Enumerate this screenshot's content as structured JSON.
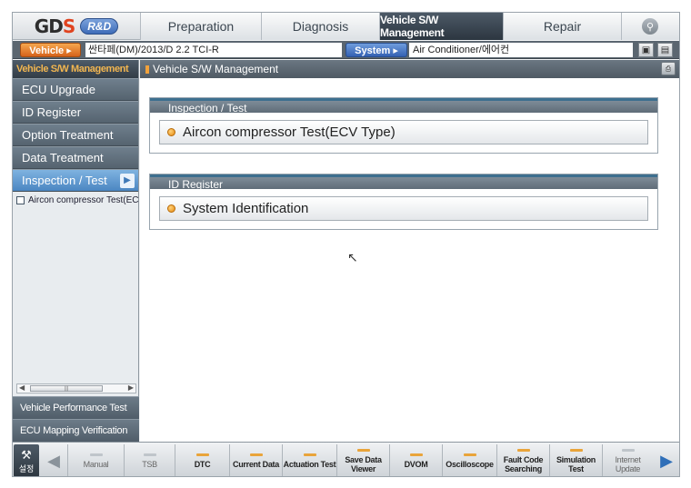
{
  "app": {
    "logo_main": "GDS",
    "logo_badge": "R&D"
  },
  "tabs": [
    {
      "label": "Preparation"
    },
    {
      "label": "Diagnosis"
    },
    {
      "label": "Vehicle S/W Management"
    },
    {
      "label": "Repair"
    }
  ],
  "vehicle_bar": {
    "vehicle_label": "Vehicle ▸",
    "vehicle_value": "싼타페(DM)/2013/D 2.2 TCI-R",
    "system_label": "System ▸",
    "system_value": "Air Conditioner/에어컨"
  },
  "sidebar": {
    "header": "Vehicle S/W Management",
    "items": [
      {
        "label": "ECU Upgrade"
      },
      {
        "label": "ID Register"
      },
      {
        "label": "Option Treatment"
      },
      {
        "label": "Data Treatment"
      },
      {
        "label": "Inspection / Test"
      }
    ],
    "sub_item": "Aircon compressor Test(ECV Type)",
    "bottom_items": [
      {
        "label": "Vehicle Performance Test"
      },
      {
        "label": "ECU Mapping Verification"
      }
    ]
  },
  "main": {
    "title": "Vehicle S/W Management",
    "groups": [
      {
        "title": "Inspection / Test",
        "item": "Aircon compressor Test(ECV Type)"
      },
      {
        "title": "ID Register",
        "item": "System Identification"
      }
    ]
  },
  "toolbar": {
    "settings_label": "설정",
    "buttons": [
      {
        "label": "Manual",
        "icon": "manual-icon"
      },
      {
        "label": "TSB",
        "icon": "tsb-icon"
      },
      {
        "label": "DTC",
        "icon": "dtc-icon"
      },
      {
        "label": "Current Data",
        "icon": "current-data-icon"
      },
      {
        "label": "Actuation Test",
        "icon": "actuation-icon"
      },
      {
        "label": "Save Data Viewer",
        "icon": "save-data-icon"
      },
      {
        "label": "DVOM",
        "icon": "dvom-icon"
      },
      {
        "label": "Oscilloscope",
        "icon": "oscilloscope-icon"
      },
      {
        "label": "Fault Code Searching",
        "icon": "fault-code-icon"
      },
      {
        "label": "Simulation Test",
        "icon": "simulation-icon"
      },
      {
        "label": "Internet Update",
        "icon": "internet-update-icon"
      }
    ]
  },
  "colors": {
    "accent_orange": "#e68a11",
    "active_tab": "#2c3640",
    "active_side": "#4b86c2"
  }
}
